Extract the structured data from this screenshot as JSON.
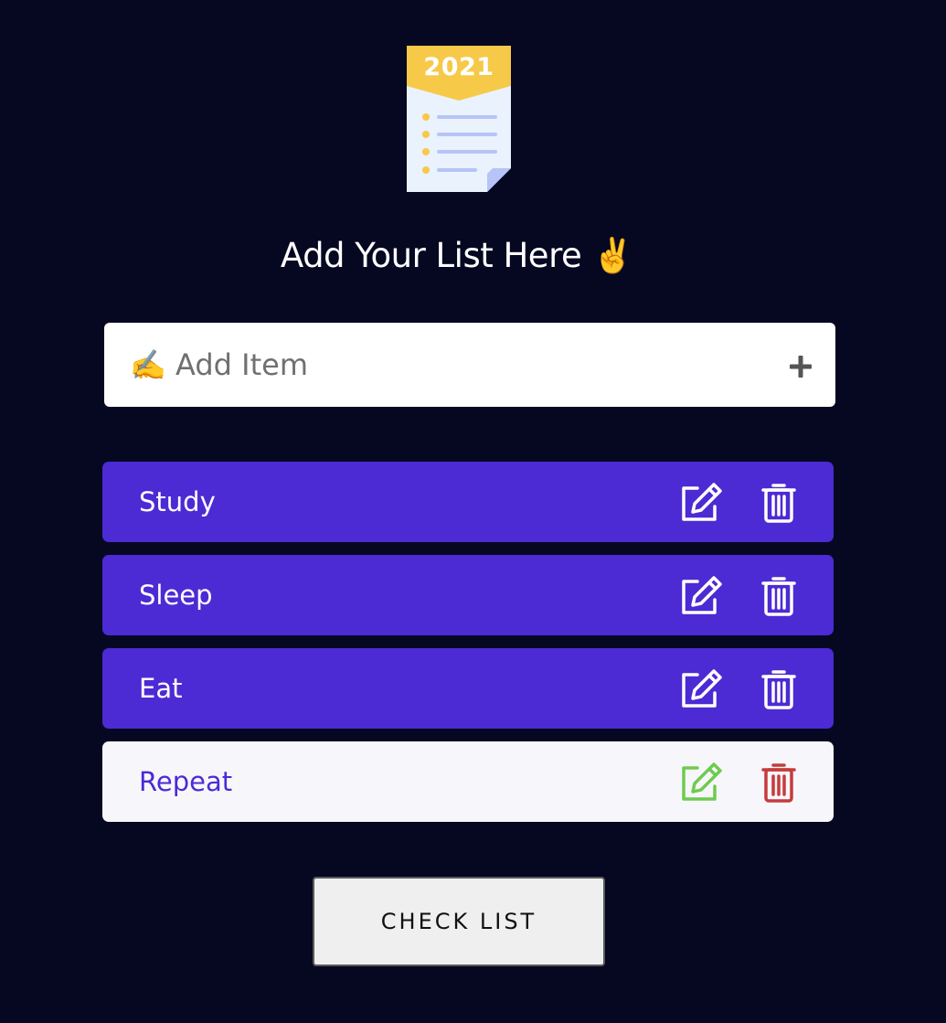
{
  "logo": {
    "year": "2021",
    "icon": "todo-list-document-icon"
  },
  "heading": "Add Your List Here ✌️",
  "add_item": {
    "placeholder": "✍️ Add Item",
    "value": "",
    "add_icon": "plus-icon"
  },
  "items": [
    {
      "label": "Study",
      "edit_icon": "edit-icon",
      "delete_icon": "trash-icon",
      "selected": false
    },
    {
      "label": "Sleep",
      "edit_icon": "edit-icon",
      "delete_icon": "trash-icon",
      "selected": false
    },
    {
      "label": "Eat",
      "edit_icon": "edit-icon",
      "delete_icon": "trash-icon",
      "selected": false
    },
    {
      "label": "Repeat",
      "edit_icon": "edit-icon",
      "delete_icon": "trash-icon",
      "selected": true
    }
  ],
  "check_button_label": "CHECK LIST",
  "colors": {
    "background": "#060822",
    "item": "#4c2bd4",
    "item_selected": "#f7f7fb",
    "edit_highlight": "#6ecb4f",
    "delete_highlight": "#c53c3c",
    "logo_accent": "#f7c948",
    "logo_paper": "#eaf2fd",
    "logo_lines": "#b7c4f7"
  }
}
